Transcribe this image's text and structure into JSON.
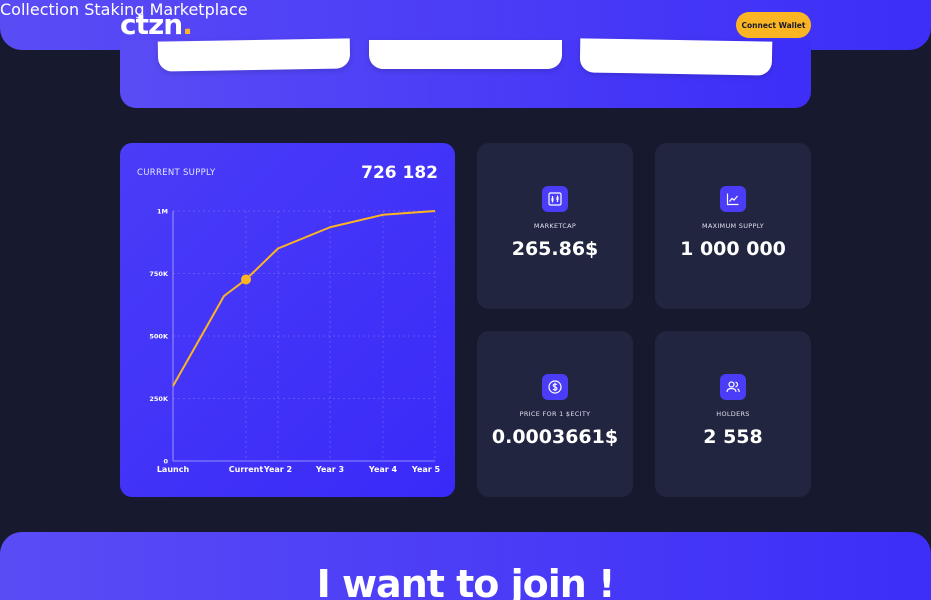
{
  "header": {
    "logo_main": "ctzn",
    "logo_dot": ".",
    "nav": [
      "Collection",
      "Staking",
      "Marketplace"
    ],
    "connect_label": "Connect Wallet"
  },
  "supply": {
    "label": "CURRENT SUPPLY",
    "value": "726 182"
  },
  "stats": [
    {
      "icon": "candlestick-chart-icon",
      "label": "MARKETCAP",
      "value": "265.86$"
    },
    {
      "icon": "line-chart-icon",
      "label": "MAXIMUM SUPPLY",
      "value": "1 000 000"
    },
    {
      "icon": "dollar-coin-icon",
      "label": "PRICE FOR 1 $ECITY",
      "value": "0.0003661$"
    },
    {
      "icon": "users-icon",
      "label": "HOLDERS",
      "value": "2 558"
    }
  ],
  "join": {
    "title": "I want to join !"
  },
  "colors": {
    "accent": "#4a3cf7",
    "line": "#fbb523",
    "card": "#22253f",
    "background": "#171a2e"
  },
  "chart_data": {
    "type": "line",
    "categories": [
      "Launch",
      "",
      "Current",
      "Year 2",
      "Year 3",
      "Year 4",
      "Year 5"
    ],
    "values": [
      300000,
      660000,
      726182,
      850000,
      935000,
      985000,
      1000000
    ],
    "highlight_index": 2,
    "ylim": [
      0,
      1000000
    ],
    "yticks": [
      {
        "value": 0,
        "label": "0"
      },
      {
        "value": 250000,
        "label": "250K"
      },
      {
        "value": 500000,
        "label": "500K"
      },
      {
        "value": 750000,
        "label": "750K"
      },
      {
        "value": 1000000,
        "label": "1M"
      }
    ],
    "xtick_labels": [
      "Launch",
      "Current",
      "Year 2",
      "Year 3",
      "Year 4",
      "Year 5"
    ],
    "grid": true
  }
}
